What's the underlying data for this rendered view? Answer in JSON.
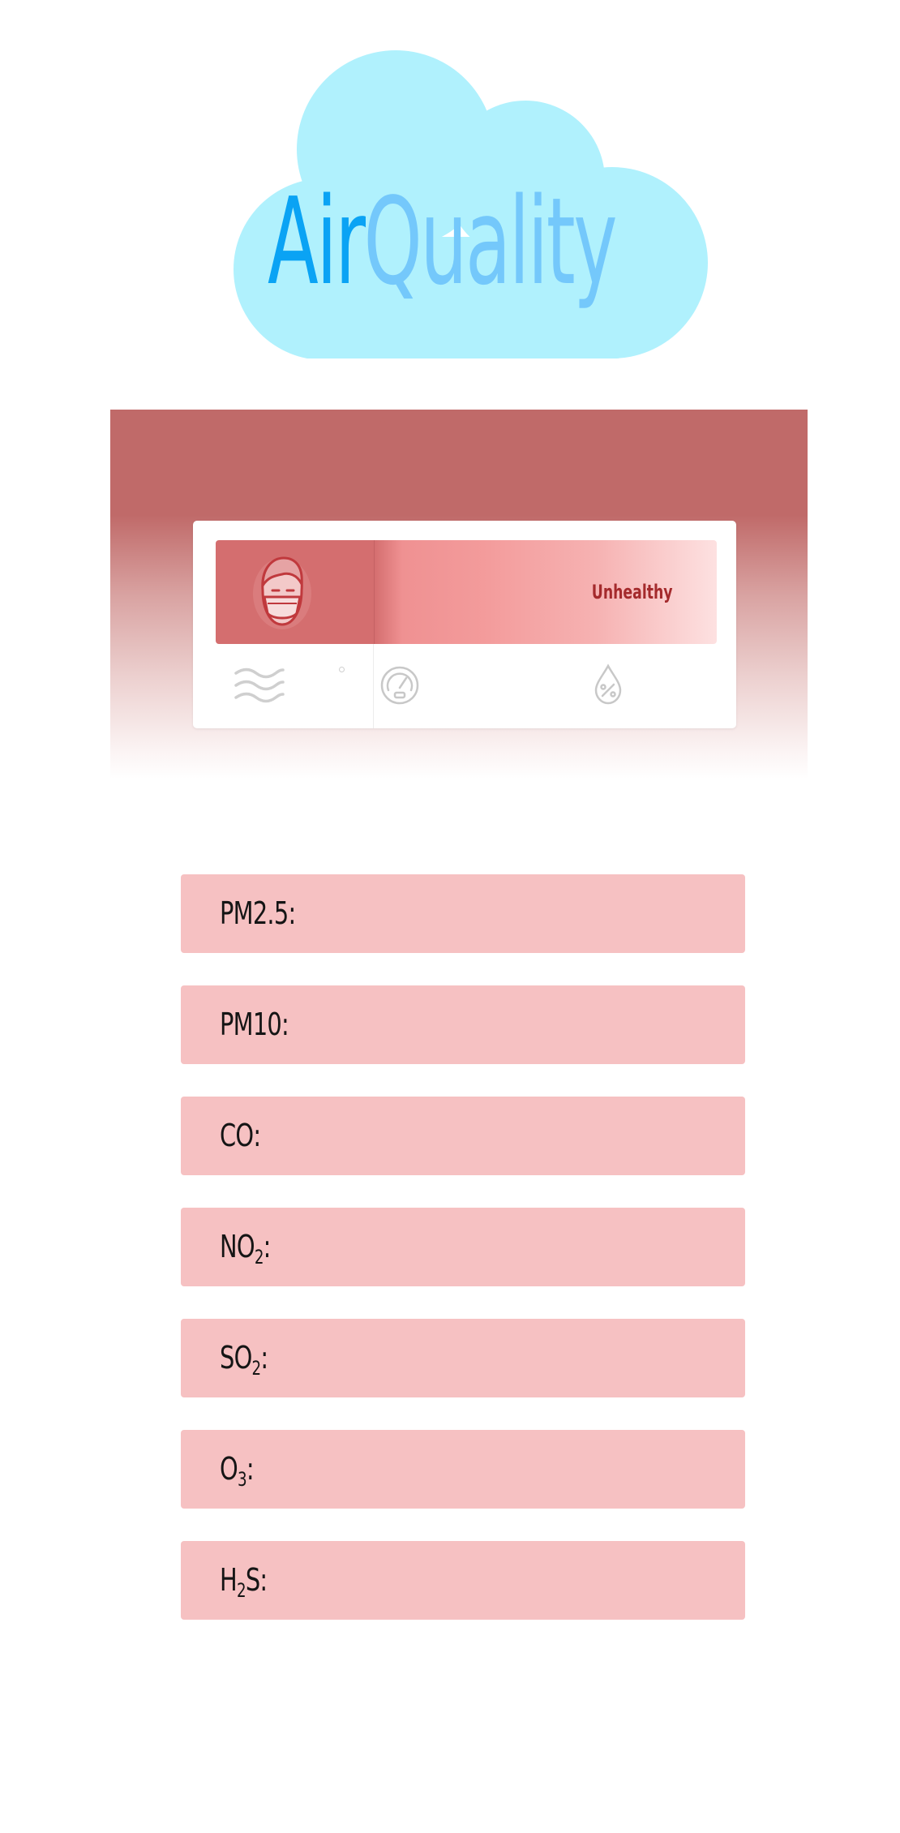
{
  "logo": {
    "word_primary": "Air",
    "word_secondary": "Quality",
    "colors": {
      "cloud": "#b0f1fd",
      "primary": "#0aa3f4",
      "secondary": "#74c8fb"
    }
  },
  "status_card": {
    "status_label": "Unhealthy",
    "icons": [
      "mask-face-icon",
      "wind-icon",
      "degree-mark",
      "gauge-icon",
      "humidity-icon"
    ],
    "colors": {
      "skyline": "#c06a69",
      "banner": "#d46e6f",
      "status_text": "#a42a2c"
    }
  },
  "pollutants": [
    {
      "name": "PM2.5",
      "sub": "",
      "suffix": ":"
    },
    {
      "name": "PM10",
      "sub": "",
      "suffix": ":"
    },
    {
      "name": "CO",
      "sub": "",
      "suffix": ":"
    },
    {
      "name": "NO",
      "sub": "2",
      "suffix": ":"
    },
    {
      "name": "SO",
      "sub": "2",
      "suffix": ":"
    },
    {
      "name": "O",
      "sub": "3",
      "suffix": ":"
    },
    {
      "name": "H",
      "sub": "2",
      "suffix": "S:"
    }
  ],
  "pollutant_row_color": "#f6c1c2"
}
